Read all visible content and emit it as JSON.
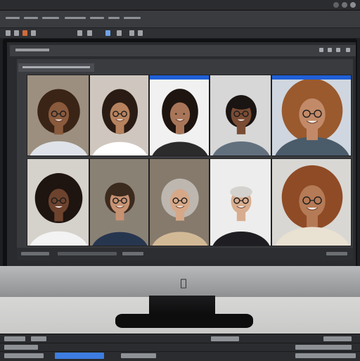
{
  "app": {
    "window_controls": [
      "minimize",
      "maximize",
      "close"
    ],
    "toolbar_icons": [
      "document-icon",
      "layers-icon",
      "brush-icon",
      "crop-icon",
      "frame-icon",
      "grid-icon",
      "settings-icon",
      "arrange-icon"
    ]
  },
  "gallery": {
    "tiles": [
      {
        "id": "tile-1",
        "background": "#9c8f80",
        "skin": "#8a5a3d",
        "hair": "#3a2416",
        "hair_style": "curly",
        "glasses": true,
        "shirt": "#dfe3e9"
      },
      {
        "id": "tile-2",
        "background": "#cfc7bf",
        "skin": "#b7825e",
        "hair": "#2a1c14",
        "hair_style": "long",
        "glasses": true,
        "shirt": "#ffffff"
      },
      {
        "id": "tile-3",
        "background": "#f1f1f1",
        "skin": "#a87558",
        "hair": "#1e1410",
        "hair_style": "long",
        "glasses": false,
        "shirt": "#2b2b2b",
        "accent_band": true
      },
      {
        "id": "tile-4",
        "background": "#d7d7d7",
        "skin": "#7a4c34",
        "hair": "#1a1412",
        "hair_style": "short-curly",
        "glasses": true,
        "shirt": "#62707e"
      },
      {
        "id": "tile-5",
        "background": "#cfd6df",
        "skin": "#c28a68",
        "hair": "#9a5a2e",
        "hair_style": "big-curly",
        "glasses": true,
        "shirt": "#4a5b6a",
        "accent_band": true
      },
      {
        "id": "tile-6",
        "background": "#d5d1cb",
        "skin": "#6d432e",
        "hair": "#1e1410",
        "hair_style": "big-curly",
        "glasses": true,
        "shirt": "#f3f3f3"
      },
      {
        "id": "tile-7",
        "background": "#8a8175",
        "skin": "#c79272",
        "hair": "#3b2a1e",
        "hair_style": "short",
        "glasses": true,
        "shirt": "#27364f"
      },
      {
        "id": "tile-8",
        "background": "#857a6c",
        "skin": "#d6a888",
        "hair": "#bdb7b0",
        "hair_style": "bob",
        "glasses": true,
        "shirt": "#d2b996"
      },
      {
        "id": "tile-9",
        "background": "#ededed",
        "skin": "#d8ad8f",
        "hair": "#d4d2ce",
        "hair_style": "balding",
        "glasses": true,
        "shirt": "#1e1e22"
      },
      {
        "id": "tile-10",
        "background": "#d9d7d3",
        "skin": "#b57a56",
        "hair": "#8f4b26",
        "hair_style": "big-curly",
        "glasses": true,
        "shirt": "#e9e1d1"
      }
    ]
  },
  "colors": {
    "chrome_dark": "#2b2c2f",
    "chrome_mid": "#3a3b3e",
    "accent_blue": "#1f5fd6",
    "monitor_silver": "#a8a9ab"
  }
}
